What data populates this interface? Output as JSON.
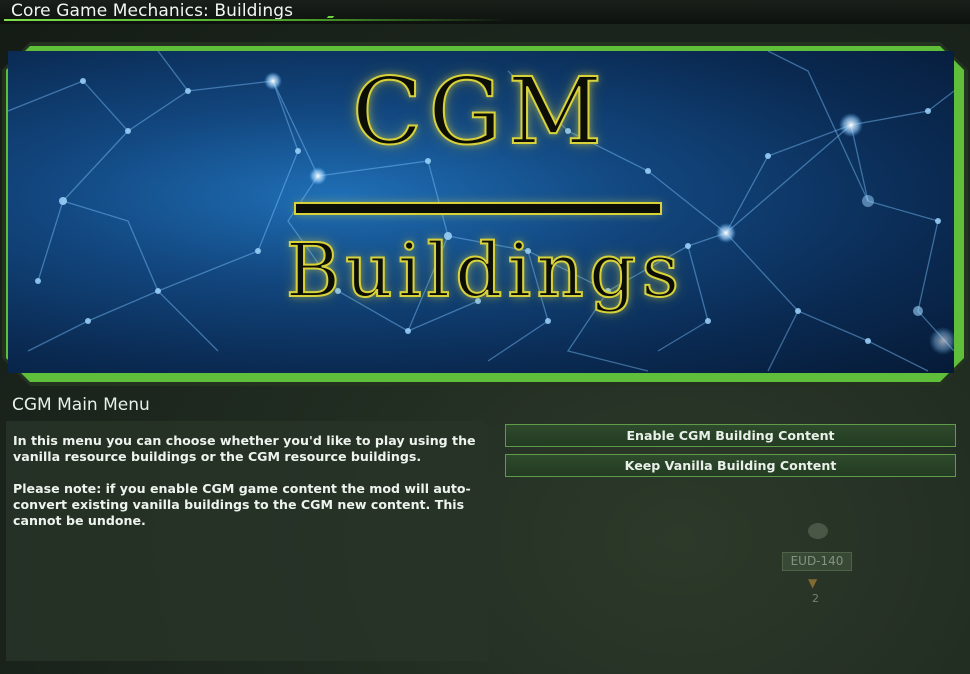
{
  "window": {
    "title": "Core Game Mechanics: Buildings"
  },
  "banner": {
    "logo_main": "CGM",
    "logo_sub": "Buildings"
  },
  "menu": {
    "heading": "CGM Main Menu",
    "description": [
      "In this menu you can choose whether you'd like to play using the vanilla resource buildings or the CGM resource buildings.",
      "Please note: if you enable CGM game content the mod will auto-convert existing vanilla buildings to the CGM new content. This cannot be undone."
    ],
    "buttons": {
      "enable": "Enable CGM Building Content",
      "keep": "Keep Vanilla Building Content"
    }
  },
  "background_map": {
    "system_label": "EUD-140",
    "count": "2",
    "icon": "resource-icon"
  },
  "colors": {
    "accent_green": "#5fbf3a",
    "logo_gold": "#d8d23a",
    "banner_blue": "#12467e"
  }
}
